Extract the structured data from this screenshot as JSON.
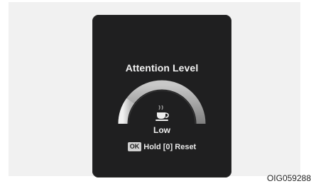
{
  "display": {
    "title": "Attention Level",
    "level": "Low",
    "level_fraction": 0.2,
    "icon": "coffee-cup-icon",
    "reset": {
      "key": "OK",
      "label": "Hold [0] Reset"
    }
  },
  "image_code": "OIG059288",
  "colors": {
    "screen": "#1f1f20",
    "gauge_track": "#a5a5a5",
    "gauge_fill": "#dcdcdc",
    "text": "#f2f2f2"
  }
}
